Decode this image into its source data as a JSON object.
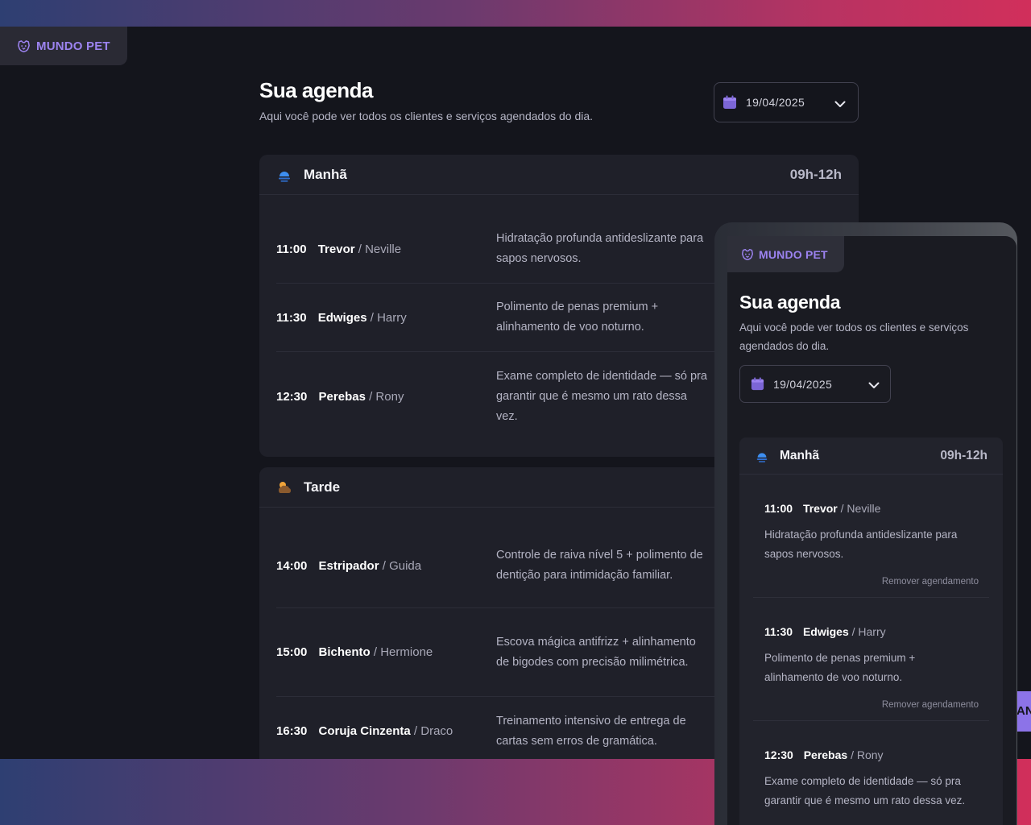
{
  "brand": {
    "name": "MUNDO PET",
    "icon": "dog-face-icon",
    "color": "#9c83f0"
  },
  "header": {
    "title": "Sua agenda",
    "subtitle": "Aqui você pode ver todos os clientes e serviços agendados do dia.",
    "date_value": "19/04/2025"
  },
  "periods": [
    {
      "name": "Manhã",
      "range": "09h-12h",
      "icon": "sunrise-icon",
      "appointments": [
        {
          "time": "11:00",
          "pet": "Trevor",
          "owner": "/ Neville",
          "service": "Hidratação profunda antideslizante para sapos nervosos."
        },
        {
          "time": "11:30",
          "pet": "Edwiges",
          "owner": "/ Harry",
          "service": "Polimento de penas premium + alinhamento de voo noturno."
        },
        {
          "time": "12:30",
          "pet": "Perebas",
          "owner": "/ Rony",
          "service": "Exame completo de identidade — só pra garantir que é mesmo um rato dessa vez."
        }
      ]
    },
    {
      "name": "Tarde",
      "range": "",
      "icon": "cloud-sun-icon",
      "appointments": [
        {
          "time": "14:00",
          "pet": "Estripador",
          "owner": "/ Guida",
          "service": "Controle de raiva nível 5 + polimento de dentição para intimidação familiar."
        },
        {
          "time": "15:00",
          "pet": "Bichento",
          "owner": "/ Hermione",
          "service": "Escova mágica antifrizz + alinhamento de bigodes com precisão milimétrica."
        },
        {
          "time": "16:30",
          "pet": "Coruja Cinzenta",
          "owner": "/ Draco",
          "service": "Treinamento intensivo de entrega de cartas sem erros de gramática."
        }
      ]
    }
  ],
  "mobile": {
    "brand": "MUNDO PET",
    "title": "Sua agenda",
    "subtitle": "Aqui você pode ver todos os clientes e serviços agendados do dia.",
    "date_value": "19/04/2025",
    "period_name": "Manhã",
    "period_range": "09h-12h",
    "remove_label": "Remover agendamento",
    "appointments": [
      {
        "time": "11:00",
        "pet": "Trevor",
        "owner": "/ Neville",
        "service": "Hidratação profunda antideslizante para sapos nervosos."
      },
      {
        "time": "11:30",
        "pet": "Edwiges",
        "owner": "/ Harry",
        "service": "Polimento de penas premium + alinhamento de voo noturno."
      },
      {
        "time": "12:30",
        "pet": "Perebas",
        "owner": "/ Rony",
        "service": "Exame completo de identidade — só pra garantir que é mesmo um rato dessa vez."
      }
    ]
  },
  "peek_button": {
    "label": "AN"
  }
}
